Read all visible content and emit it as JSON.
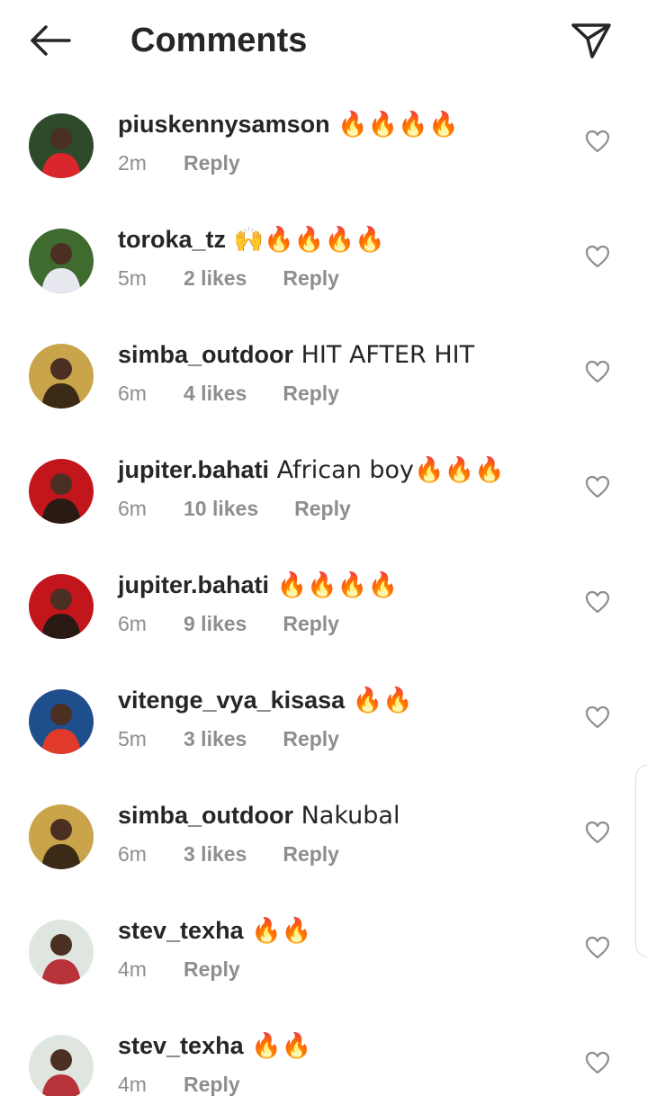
{
  "header": {
    "title": "Comments",
    "back_icon": "arrow-left-icon",
    "share_icon": "paper-plane-icon"
  },
  "comments": [
    {
      "username": "piuskennysamson",
      "text": " 🔥🔥🔥🔥",
      "time": "2m",
      "likes": "",
      "reply": "Reply",
      "avatar": {
        "bg": "#2e4a2b",
        "accent": "#d9262b"
      }
    },
    {
      "username": "toroka_tz",
      "text": " 🙌🔥🔥🔥🔥",
      "time": "5m",
      "likes": "2 likes",
      "reply": "Reply",
      "avatar": {
        "bg": "#3f6b2f",
        "accent": "#e8e8f0"
      }
    },
    {
      "username": "simba_outdoor",
      "text": " HIT AFTER HIT",
      "time": "6m",
      "likes": "4 likes",
      "reply": "Reply",
      "avatar": {
        "bg": "#c9a44a",
        "accent": "#3b2a16"
      }
    },
    {
      "username": "jupiter.bahati",
      "text": " African boy🔥🔥🔥",
      "time": "6m",
      "likes": "10 likes",
      "reply": "Reply",
      "avatar": {
        "bg": "#c3161c",
        "accent": "#2a1a14"
      }
    },
    {
      "username": "jupiter.bahati",
      "text": " 🔥🔥🔥🔥",
      "time": "6m",
      "likes": "9 likes",
      "reply": "Reply",
      "avatar": {
        "bg": "#c3161c",
        "accent": "#2a1a14"
      }
    },
    {
      "username": "vitenge_vya_kisasa",
      "text": " 🔥🔥",
      "time": "5m",
      "likes": "3 likes",
      "reply": "Reply",
      "avatar": {
        "bg": "#1e4e8c",
        "accent": "#e23a2a"
      }
    },
    {
      "username": "simba_outdoor",
      "text": " Nakubal",
      "time": "6m",
      "likes": "3 likes",
      "reply": "Reply",
      "avatar": {
        "bg": "#c9a44a",
        "accent": "#3b2a16"
      }
    },
    {
      "username": "stev_texha",
      "text": " 🔥🔥",
      "time": "4m",
      "likes": "",
      "reply": "Reply",
      "avatar": {
        "bg": "#dfe6df",
        "accent": "#b8323a"
      }
    },
    {
      "username": "stev_texha",
      "text": " 🔥🔥",
      "time": "4m",
      "likes": "",
      "reply": "Reply",
      "avatar": {
        "bg": "#dfe6df",
        "accent": "#b8323a"
      }
    }
  ],
  "icons": {
    "like": "heart-outline-icon"
  }
}
